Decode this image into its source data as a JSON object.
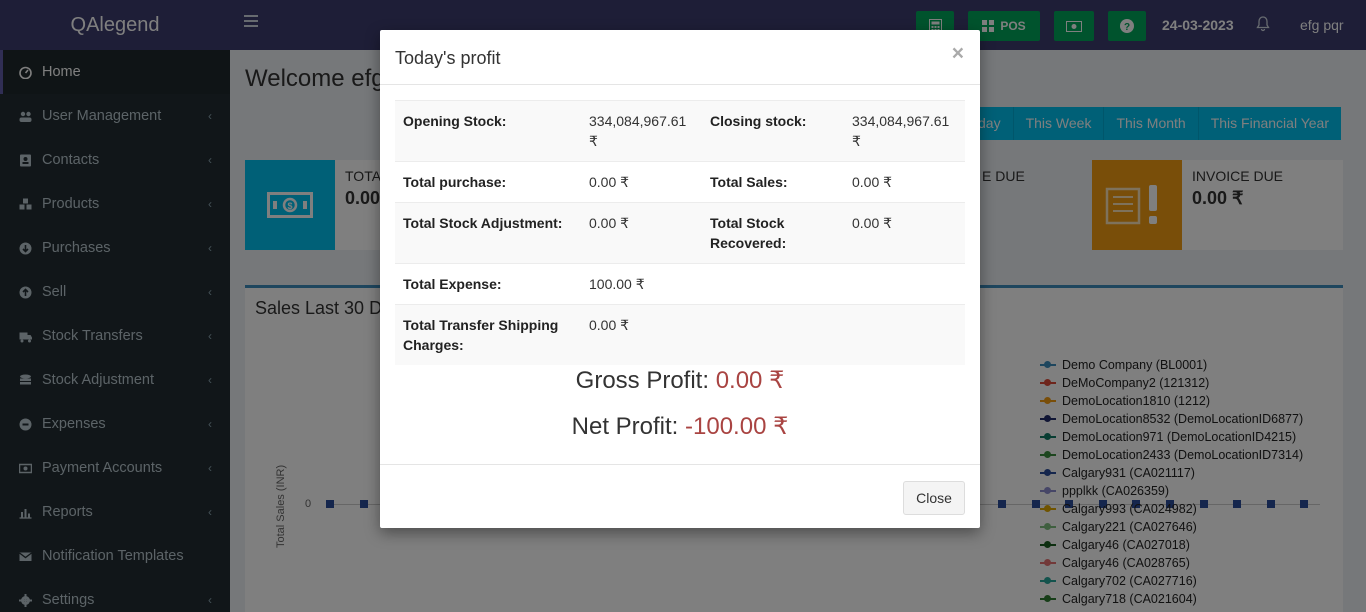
{
  "app": {
    "logo": "QAlegend"
  },
  "sidebar": {
    "items": [
      {
        "label": "Home",
        "icon": "dashboard-icon",
        "active": true
      },
      {
        "label": "User Management",
        "icon": "users-icon"
      },
      {
        "label": "Contacts",
        "icon": "contacts-icon"
      },
      {
        "label": "Products",
        "icon": "cubes-icon"
      },
      {
        "label": "Purchases",
        "icon": "arrow-circle-down-icon"
      },
      {
        "label": "Sell",
        "icon": "arrow-circle-up-icon"
      },
      {
        "label": "Stock Transfers",
        "icon": "truck-icon"
      },
      {
        "label": "Stock Adjustment",
        "icon": "database-icon"
      },
      {
        "label": "Expenses",
        "icon": "minus-circle-icon"
      },
      {
        "label": "Payment Accounts",
        "icon": "money-icon"
      },
      {
        "label": "Reports",
        "icon": "bar-chart-icon"
      },
      {
        "label": "Notification Templates",
        "icon": "envelope-icon"
      },
      {
        "label": "Settings",
        "icon": "cog-icon"
      }
    ]
  },
  "header": {
    "pos_label": "POS",
    "date": "24-03-2023",
    "user": "efg pqr"
  },
  "main": {
    "welcome": "Welcome efg",
    "filters": [
      "day",
      "This Week",
      "This Month",
      "This Financial Year"
    ],
    "cards": {
      "total": {
        "label": "TOTA",
        "value": "0.00"
      },
      "due": {
        "label": "E DUE"
      },
      "invoice_due": {
        "label": "INVOICE DUE",
        "value": "0.00 ₹"
      }
    },
    "sales_title": "Sales Last 30 D",
    "y_axis_label": "Total Sales (INR)",
    "y_zero": "0",
    "legend": [
      {
        "name": "Demo Company (BL0001)",
        "color": "#3c8dbc"
      },
      {
        "name": "DeMoCompany2 (121312)",
        "color": "#dd4b39"
      },
      {
        "name": "DemoLocation1810 (1212)",
        "color": "#f39c12"
      },
      {
        "name": "DemoLocation8532 (DemoLocationID6877)",
        "color": "#222d6b"
      },
      {
        "name": "DemoLocation971 (DemoLocationID4215)",
        "color": "#117a65"
      },
      {
        "name": "DemoLocation2433 (DemoLocationID7314)",
        "color": "#3a8d3e"
      },
      {
        "name": "Calgary931 (CA021117)",
        "color": "#2b4c9b"
      },
      {
        "name": "ppplkk (CA026359)",
        "color": "#8c8ccf"
      },
      {
        "name": "Calgary993 (CA024982)",
        "color": "#e0a800"
      },
      {
        "name": "Calgary221 (CA027646)",
        "color": "#7fbf7f"
      },
      {
        "name": "Calgary46 (CA027018)",
        "color": "#1b5e20"
      },
      {
        "name": "Calgary46 (CA028765)",
        "color": "#e57373"
      },
      {
        "name": "Calgary702 (CA027716)",
        "color": "#26a69a"
      },
      {
        "name": "Calgary718 (CA021604)",
        "color": "#2e7d32"
      }
    ]
  },
  "modal": {
    "title": "Today's profit",
    "close_x": "×",
    "rows": [
      {
        "k1": "Opening Stock:",
        "v1": "334,084,967.61 ₹",
        "k2": "Closing stock:",
        "v2": "334,084,967.61 ₹"
      },
      {
        "k1": "Total purchase:",
        "v1": "0.00 ₹",
        "k2": "Total Sales:",
        "v2": "0.00 ₹"
      },
      {
        "k1": "Total Stock Adjustment:",
        "v1": "0.00 ₹",
        "k2": "Total Stock Recovered:",
        "v2": "0.00 ₹"
      },
      {
        "k1": "Total Expense:",
        "v1": "100.00 ₹",
        "k2": "",
        "v2": ""
      },
      {
        "k1": "Total Transfer Shipping Charges:",
        "v1": "0.00 ₹",
        "k2": "",
        "v2": ""
      }
    ],
    "gross_label": "Gross Profit:",
    "gross_value": "0.00 ₹",
    "net_label": "Net Profit:",
    "net_value": "-100.00 ₹",
    "close_button": "Close"
  }
}
